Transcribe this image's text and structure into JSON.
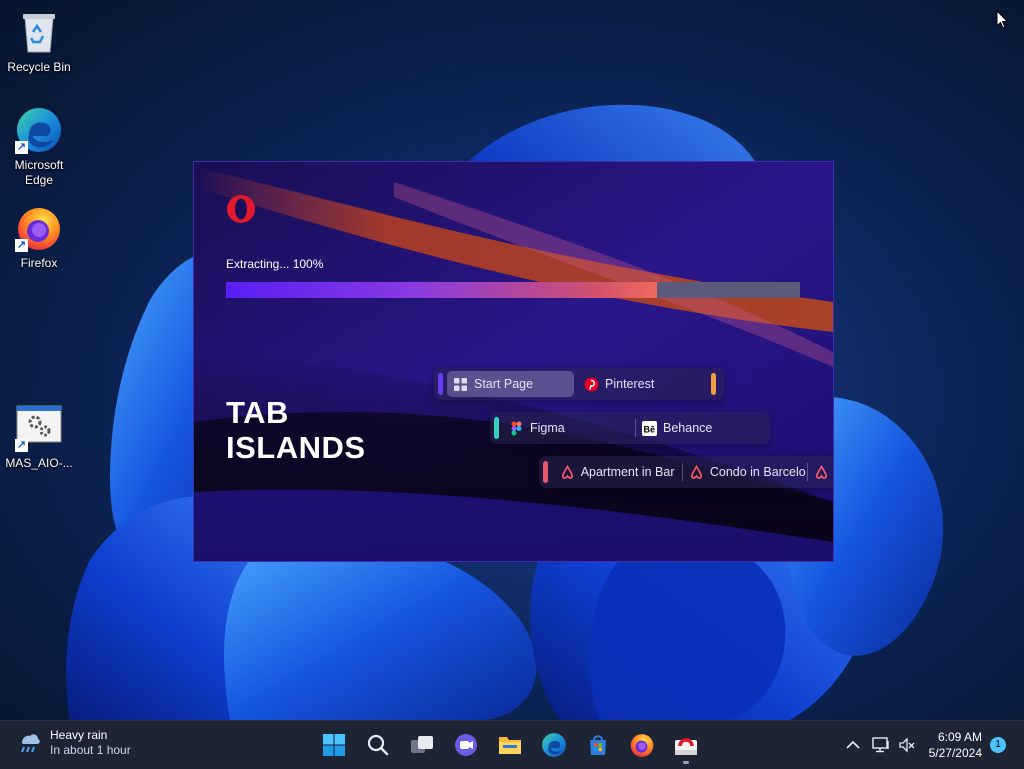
{
  "desktop": {
    "icons": [
      {
        "label": "Recycle Bin",
        "icon": "recycle-bin-icon"
      },
      {
        "label": "Microsoft Edge",
        "icon": "edge-icon"
      },
      {
        "label": "Firefox",
        "icon": "firefox-icon"
      },
      {
        "label": "MAS_AIO-...",
        "icon": "script-file-icon"
      }
    ]
  },
  "installer": {
    "status": "Extracting... 100%",
    "progress_visual_fraction": 0.75,
    "title": "TAB ISLANDS",
    "islands": [
      {
        "accent": "#6a3cf0",
        "end_accent": "#f0a040",
        "tabs": [
          {
            "label": "Start Page",
            "icon": "start-page-grid-icon",
            "active": true
          },
          {
            "label": "Pinterest",
            "icon": "pinterest-icon",
            "active": false
          }
        ]
      },
      {
        "accent": "#35d0c0",
        "tabs": [
          {
            "label": "Figma",
            "icon": "figma-icon",
            "active": false
          },
          {
            "label": "Behance",
            "icon": "behance-icon",
            "active": false
          }
        ]
      },
      {
        "accent": "#e85a6a",
        "tabs": [
          {
            "label": "Apartment in Bar",
            "icon": "airbnb-icon",
            "active": false
          },
          {
            "label": "Condo in Barcelo",
            "icon": "airbnb-icon",
            "active": false
          }
        ]
      }
    ],
    "colors": {
      "accent_purple": "#5a1ff5",
      "opera_red": "#e3192b"
    }
  },
  "taskbar": {
    "weather": {
      "title": "Heavy rain",
      "subtitle": "In about 1 hour",
      "icon": "rain-cloud-icon"
    },
    "apps": [
      {
        "name": "start-button",
        "icon": "windows-logo-icon"
      },
      {
        "name": "search-button",
        "icon": "search-icon"
      },
      {
        "name": "task-view-button",
        "icon": "task-view-icon"
      },
      {
        "name": "chat-button",
        "icon": "teams-chat-icon"
      },
      {
        "name": "file-explorer-button",
        "icon": "folder-icon"
      },
      {
        "name": "edge-taskbar-button",
        "icon": "edge-icon"
      },
      {
        "name": "store-button",
        "icon": "store-icon"
      },
      {
        "name": "firefox-taskbar-button",
        "icon": "firefox-icon"
      },
      {
        "name": "opera-installer-taskbar-button",
        "icon": "opera-installer-icon",
        "running": true
      }
    ],
    "clock": {
      "time": "6:09 AM",
      "date": "5/27/2024"
    },
    "notification_count": "1"
  }
}
